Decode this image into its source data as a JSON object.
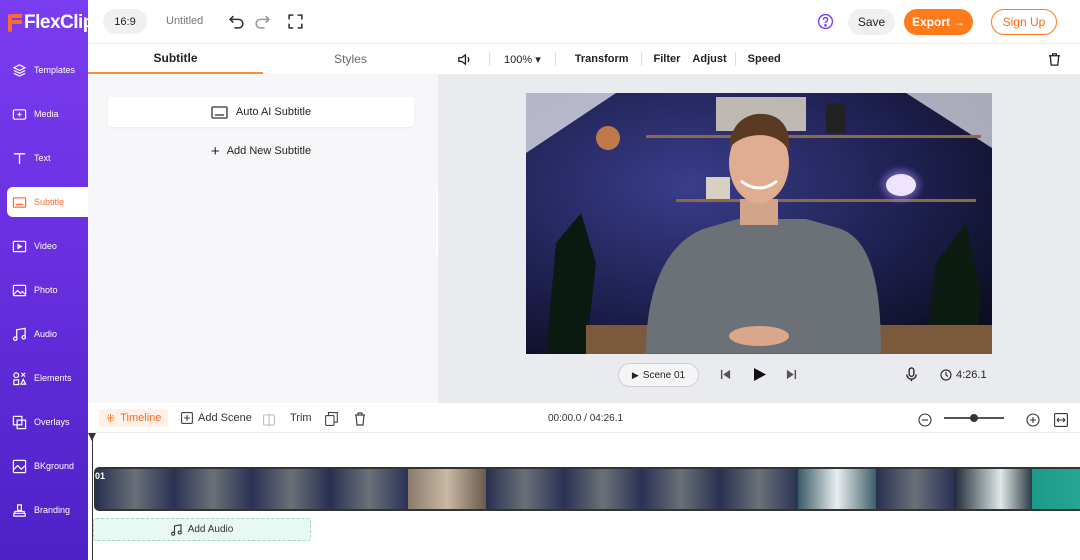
{
  "brand": {
    "logo": "FlexClip"
  },
  "sidebar": {
    "items": [
      {
        "label": "Templates",
        "icon": "layers-icon"
      },
      {
        "label": "Media",
        "icon": "media-folder-icon"
      },
      {
        "label": "Text",
        "icon": "text-icon"
      },
      {
        "label": "Subtitle",
        "icon": "subtitle-icon"
      },
      {
        "label": "Video",
        "icon": "video-icon"
      },
      {
        "label": "Photo",
        "icon": "photo-icon"
      },
      {
        "label": "Audio",
        "icon": "music-note-icon"
      },
      {
        "label": "Elements",
        "icon": "elements-icon"
      },
      {
        "label": "Overlays",
        "icon": "overlays-icon"
      },
      {
        "label": "BKground",
        "icon": "background-icon"
      },
      {
        "label": "Branding",
        "icon": "branding-icon"
      }
    ],
    "active_index": 3
  },
  "topbar": {
    "ratio": "16:9",
    "title": "Untitled",
    "save": "Save",
    "export": "Export",
    "signup": "Sign Up"
  },
  "panel": {
    "tabs": [
      "Subtitle",
      "Styles"
    ],
    "auto_ai": "Auto AI Subtitle",
    "add_new": "Add New Subtitle"
  },
  "toolbar": {
    "zoom": "100%",
    "transform": "Transform",
    "filter": "Filter",
    "adjust": "Adjust",
    "speed": "Speed"
  },
  "player": {
    "scene": "Scene 01",
    "duration": "4:26.1"
  },
  "timeline": {
    "timeline": "Timeline",
    "add_scene": "Add Scene",
    "trim": "Trim",
    "timecode": "00:00.0 / 04:26.1",
    "scene_badge": "01",
    "add_audio": "Add Audio"
  },
  "colors": {
    "accent": "#ff7a1a",
    "sidebar": "#6a2fe0"
  }
}
